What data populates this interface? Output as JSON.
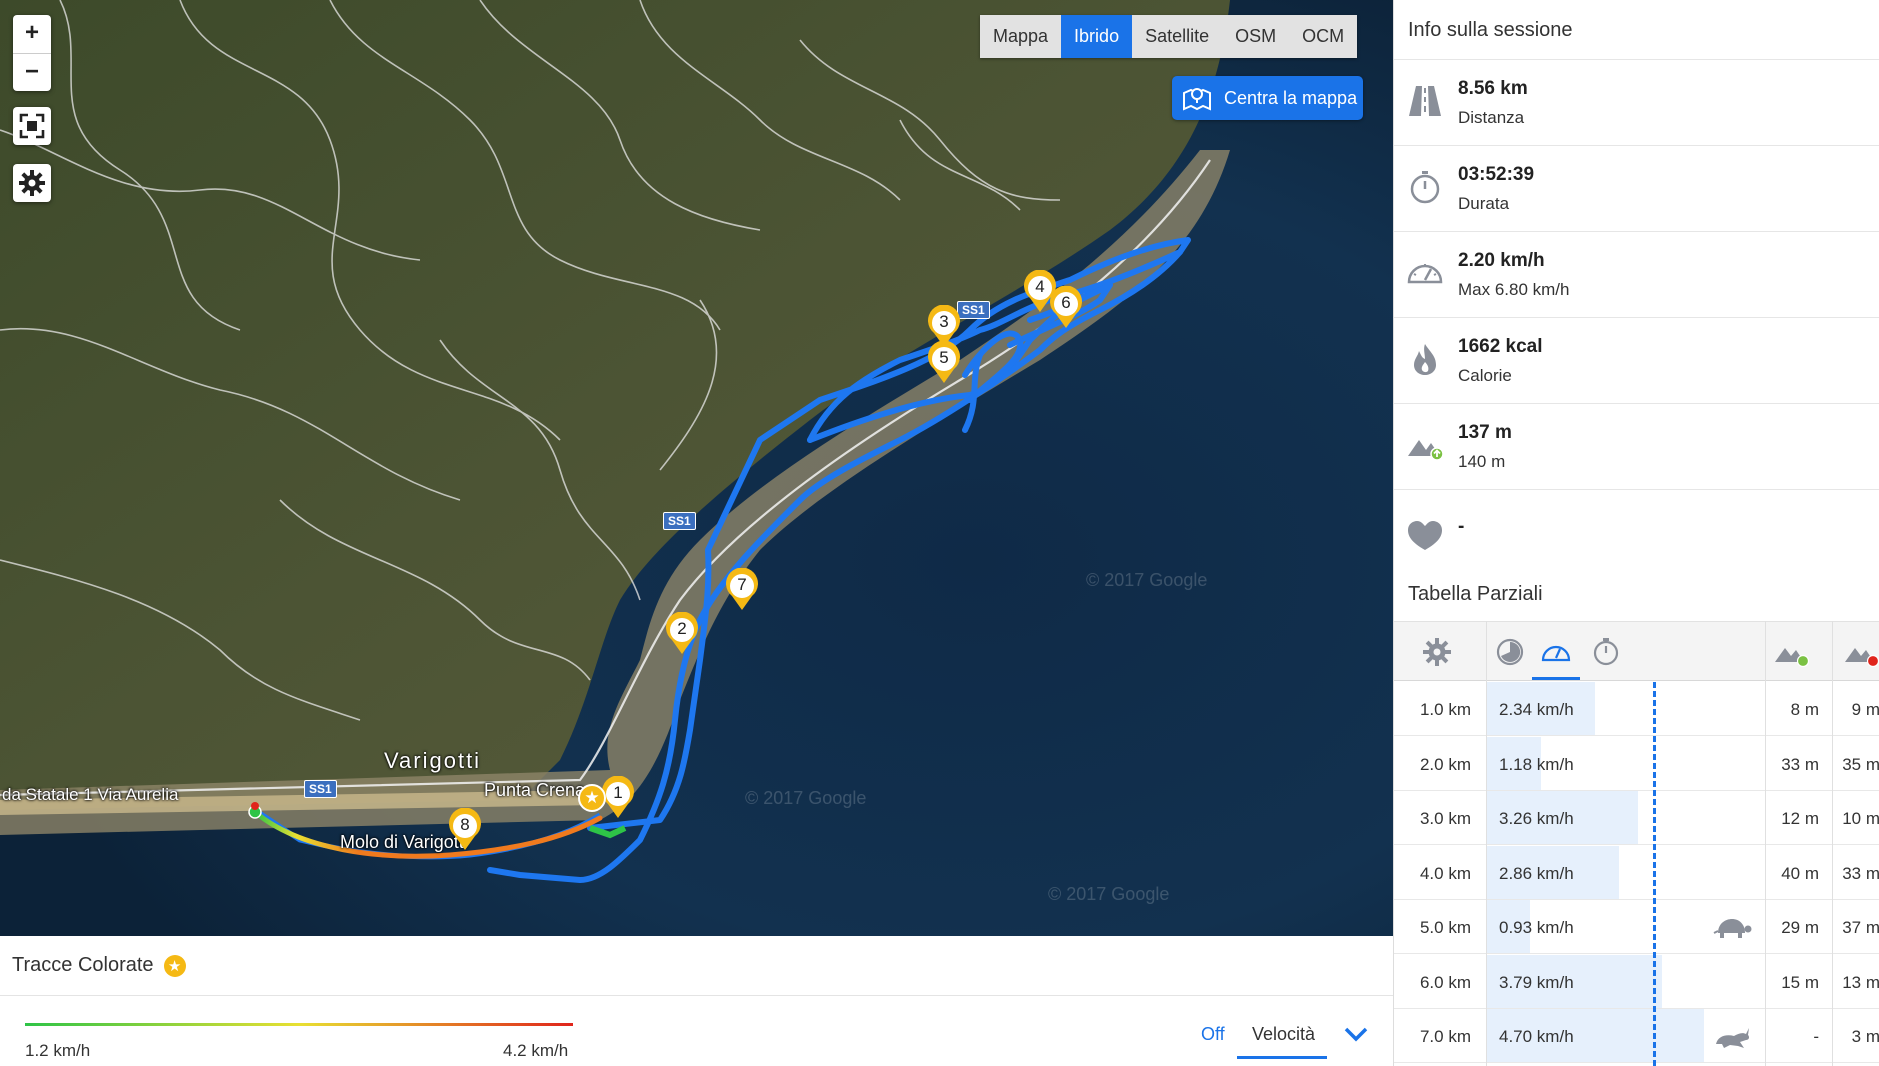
{
  "map": {
    "layer_buttons": [
      "Mappa",
      "Ibrido",
      "Satellite",
      "OSM",
      "OCM"
    ],
    "active_layer": "Ibrido",
    "center_button_label": "Centra la mappa",
    "zoom_in": "+",
    "zoom_out": "−",
    "labels": {
      "town": "Varigotti",
      "street": "da Statale 1 Via Aurelia",
      "point": "Punta Crena",
      "pier": "Molo di Varigotti",
      "road_ss1": "SS1"
    },
    "watermark": "© 2017 Google",
    "markers": [
      "1",
      "2",
      "3",
      "4",
      "5",
      "6",
      "7",
      "8"
    ],
    "track_color": "#1e77f0"
  },
  "bottom": {
    "title": "Tracce Colorate",
    "min_label": "1.2 km/h",
    "max_label": "4.2 km/h",
    "off_label": "Off",
    "mode_label": "Velocità"
  },
  "session": {
    "title": "Info sulla sessione",
    "distance": "8.56 km",
    "distance_label": "Distanza",
    "duration": "03:52:39",
    "duration_label": "Durata",
    "speed": "2.20 km/h",
    "speed_max": "Max 6.80 km/h",
    "calories": "1662 kcal",
    "calories_label": "Calorie",
    "ascent": "137 m",
    "ascent_sub": "140 m",
    "heart": "-"
  },
  "splits": {
    "title": "Tabella Parziali",
    "rows": [
      {
        "km": "1.0 km",
        "speed": "2.34 km/h",
        "speed_value": 2.34,
        "up": "8 m",
        "down": "9 m",
        "animal": ""
      },
      {
        "km": "2.0 km",
        "speed": "1.18 km/h",
        "speed_value": 1.18,
        "up": "33 m",
        "down": "35 m",
        "animal": ""
      },
      {
        "km": "3.0 km",
        "speed": "3.26 km/h",
        "speed_value": 3.26,
        "up": "12 m",
        "down": "10 m",
        "animal": ""
      },
      {
        "km": "4.0 km",
        "speed": "2.86 km/h",
        "speed_value": 2.86,
        "up": "40 m",
        "down": "33 m",
        "animal": ""
      },
      {
        "km": "5.0 km",
        "speed": "0.93 km/h",
        "speed_value": 0.93,
        "up": "29 m",
        "down": "37 m",
        "animal": "turtle-icon"
      },
      {
        "km": "6.0 km",
        "speed": "3.79 km/h",
        "speed_value": 3.79,
        "up": "15 m",
        "down": "13 m",
        "animal": ""
      },
      {
        "km": "7.0 km",
        "speed": "4.70 km/h",
        "speed_value": 4.7,
        "up": "-",
        "down": "3 m",
        "animal": "rabbit-icon"
      }
    ]
  },
  "colors": {
    "accent": "#1a73e8",
    "marker": "#f5b914",
    "gradient_start": "#2ec447",
    "gradient_mid": "#e8e032",
    "gradient_end": "#e0241b"
  }
}
